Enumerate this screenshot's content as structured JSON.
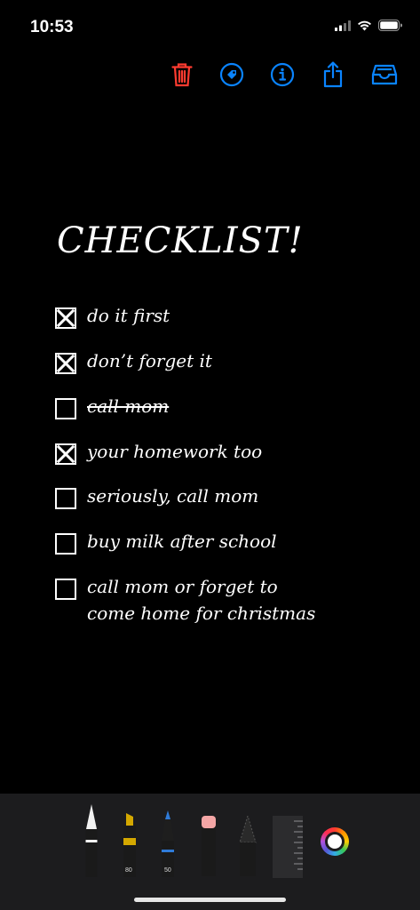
{
  "status": {
    "time": "10:53"
  },
  "toolbar": {
    "items": [
      {
        "name": "delete",
        "icon": "trash-icon",
        "color": "#ff3b30"
      },
      {
        "name": "tag",
        "icon": "tag-icon",
        "color": "#0a84ff"
      },
      {
        "name": "info",
        "icon": "info-icon",
        "color": "#0a84ff"
      },
      {
        "name": "share",
        "icon": "share-icon",
        "color": "#0a84ff"
      },
      {
        "name": "archive",
        "icon": "tray-icon",
        "color": "#0a84ff"
      }
    ]
  },
  "note": {
    "title": "CHECKLIST!",
    "items": [
      {
        "text": "do it first",
        "checked": true,
        "struck": false
      },
      {
        "text": "don’t forget it",
        "checked": true,
        "struck": false
      },
      {
        "text": "call mom",
        "checked": false,
        "struck": true
      },
      {
        "text": "your homework too",
        "checked": true,
        "struck": false
      },
      {
        "text": "seriously, call mom",
        "checked": false,
        "struck": false
      },
      {
        "text": "buy milk after school",
        "checked": false,
        "struck": false
      },
      {
        "text": "call mom or forget to\ncome home for christmas",
        "checked": false,
        "struck": false
      }
    ]
  },
  "palette": {
    "tools": [
      {
        "name": "pen",
        "icon": "pen-icon"
      },
      {
        "name": "marker",
        "icon": "marker-icon",
        "label": "80",
        "color": "#e6b800"
      },
      {
        "name": "pencil",
        "icon": "pencil-icon",
        "label": "50",
        "color": "#2f7bd8"
      },
      {
        "name": "eraser",
        "icon": "eraser-icon"
      },
      {
        "name": "lasso",
        "icon": "lasso-icon"
      },
      {
        "name": "ruler",
        "icon": "ruler-icon"
      }
    ],
    "color_picker": {
      "icon": "color-wheel-icon",
      "selected": "#ffffff"
    }
  }
}
